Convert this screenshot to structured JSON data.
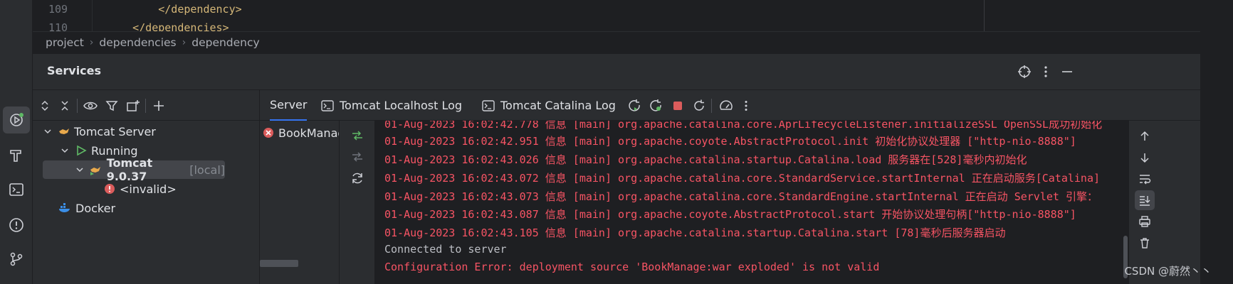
{
  "editor": {
    "lines": [
      {
        "num": "109",
        "code": "        </dependency>"
      },
      {
        "num": "110",
        "code": "    </dependencies>"
      }
    ]
  },
  "breadcrumb": [
    "project",
    "dependencies",
    "dependency"
  ],
  "panel": {
    "title": "Services",
    "header_icons": [
      "crosshair-icon",
      "more-vertical-icon",
      "minimize-icon"
    ]
  },
  "toolbar_left_icons": [
    "expand-all-icon",
    "collapse-all-icon",
    "eye-icon",
    "filter-icon",
    "new-tab-icon",
    "add-icon"
  ],
  "tabs": [
    {
      "label": "Server",
      "active": true
    },
    {
      "label": "Tomcat Localhost Log",
      "active": false
    },
    {
      "label": "Tomcat Catalina Log",
      "active": false
    }
  ],
  "tree": {
    "server": "Tomcat Server",
    "running": "Running",
    "tomcat": "Tomcat 9.0.37",
    "tomcat_tag": "[local]",
    "invalid": "<invalid>",
    "docker": "Docker"
  },
  "deployment": {
    "name": "BookManage"
  },
  "console": [
    {
      "text": "01-Aug-2023 16:02:42.778 信息 [main] org.apache.catalina.core.AprLifecycleListener.initializeSSL OpenSSL成功初始化",
      "cls": "err"
    },
    {
      "text": "01-Aug-2023 16:02:42.951 信息 [main] org.apache.coyote.AbstractProtocol.init 初始化协议处理器 [\"http-nio-8888\"]",
      "cls": "err"
    },
    {
      "text": "01-Aug-2023 16:02:43.026 信息 [main] org.apache.catalina.startup.Catalina.load 服务器在[528]毫秒内初始化",
      "cls": "err"
    },
    {
      "text": "01-Aug-2023 16:02:43.072 信息 [main] org.apache.catalina.core.StandardService.startInternal 正在启动服务[Catalina]",
      "cls": "err"
    },
    {
      "text": "01-Aug-2023 16:02:43.073 信息 [main] org.apache.catalina.core.StandardEngine.startInternal 正在启动 Servlet 引擎：",
      "cls": "err"
    },
    {
      "text": "01-Aug-2023 16:02:43.087 信息 [main] org.apache.coyote.AbstractProtocol.start 开始协议处理句柄[\"http-nio-8888\"]",
      "cls": "err"
    },
    {
      "text": "01-Aug-2023 16:02:43.105 信息 [main] org.apache.catalina.startup.Catalina.start [78]毫秒后服务器启动",
      "cls": "err"
    },
    {
      "text": "Connected to server",
      "cls": "ok"
    },
    {
      "text": "Configuration Error: deployment source 'BookManage:war exploded' is not valid",
      "cls": "err"
    }
  ],
  "watermark": "CSDN @蔚然丶丶",
  "colors": {
    "accent": "#3574f0",
    "error": "#f75464",
    "running": "#5fb865"
  }
}
